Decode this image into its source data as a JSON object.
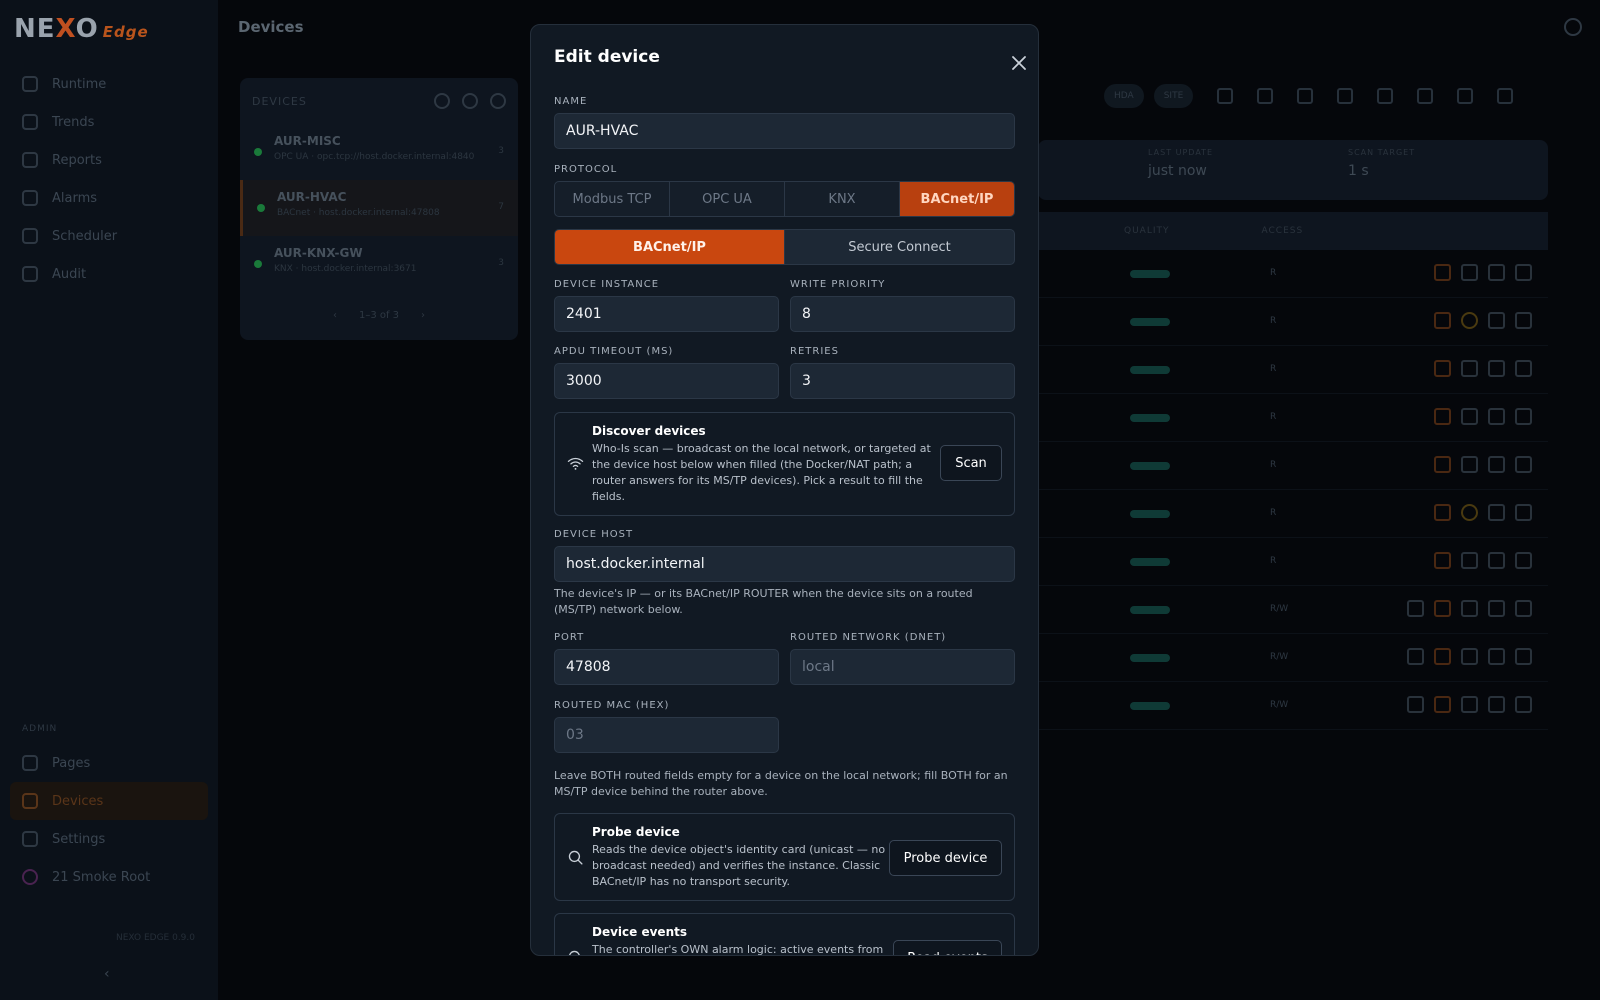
{
  "app": {
    "logo": {
      "part1": "NE",
      "part2": "X",
      "part3": "O",
      "suffix": "Edge"
    },
    "page_title": "Devices",
    "nav": [
      {
        "label": "Runtime"
      },
      {
        "label": "Trends"
      },
      {
        "label": "Reports"
      },
      {
        "label": "Alarms"
      },
      {
        "label": "Scheduler"
      },
      {
        "label": "Audit"
      }
    ],
    "nav_section": "ADMIN",
    "nav_bottom": [
      {
        "label": "Pages"
      },
      {
        "label": "Devices"
      },
      {
        "label": "Settings"
      },
      {
        "label": "21 Smoke Root"
      }
    ],
    "version": "NEXO EDGE 0.9.0",
    "devices_panel": {
      "header": "DEVICES",
      "items": [
        {
          "name": "AUR-MISC",
          "sub": "OPC UA · opc.tcp://host.docker.internal:4840",
          "count": "3"
        },
        {
          "name": "AUR-HVAC",
          "sub": "BACnet · host.docker.internal:47808",
          "count": "7"
        },
        {
          "name": "AUR-KNX-GW",
          "sub": "KNX · host.docker.internal:3671",
          "count": "3"
        }
      ],
      "pager": "1–3 of 3"
    },
    "summary": {
      "last_update_label": "LAST UPDATE",
      "last_update_value": "just now",
      "scan_target_label": "SCAN TARGET",
      "scan_target_value": "1 s"
    },
    "toolbar": {
      "pill1": "HDA",
      "pill2": "SITE"
    },
    "table": {
      "col_quality": "QUALITY",
      "col_access": "ACCESS",
      "rows": [
        "R",
        "R",
        "R",
        "R",
        "R",
        "R",
        "R",
        "R/W",
        "R/W",
        "R/W"
      ]
    }
  },
  "modal": {
    "title": "Edit device",
    "name_label": "NAME",
    "name_value": "AUR-HVAC",
    "protocol_label": "PROTOCOL",
    "protocols": [
      "Modbus TCP",
      "OPC UA",
      "KNX",
      "BACnet/IP"
    ],
    "protocol_selected": 3,
    "transports": [
      "BACnet/IP",
      "Secure Connect"
    ],
    "transport_selected": 0,
    "device_instance_label": "DEVICE INSTANCE",
    "device_instance_value": "2401",
    "write_priority_label": "WRITE PRIORITY",
    "write_priority_value": "8",
    "apdu_timeout_label": "APDU TIMEOUT (MS)",
    "apdu_timeout_value": "3000",
    "retries_label": "RETRIES",
    "retries_value": "3",
    "discover": {
      "title": "Discover devices",
      "text": "Who-Is scan — broadcast on the local network, or targeted at the device host below when filled (the Docker/NAT path; a router answers for its MS/TP devices). Pick a result to fill the fields.",
      "button": "Scan"
    },
    "device_host_label": "DEVICE HOST",
    "device_host_value": "host.docker.internal",
    "device_host_help": "The device's IP — or its BACnet/IP ROUTER when the device sits on a routed (MS/TP) network below.",
    "port_label": "PORT",
    "port_value": "47808",
    "routed_network_label": "ROUTED NETWORK (DNET)",
    "routed_network_placeholder": "local",
    "routed_mac_label": "ROUTED MAC (HEX)",
    "routed_mac_placeholder": "03",
    "routed_help": "Leave BOTH routed fields empty for a device on the local network; fill BOTH for an MS/TP device behind the router above.",
    "probe": {
      "title": "Probe device",
      "text": "Reads the device object's identity card (unicast — no broadcast needed) and verifies the instance. Classic BACnet/IP has no transport security.",
      "button": "Probe device"
    },
    "events": {
      "title": "Device events",
      "text": "The controller's OWN alarm logic: active events from",
      "button": "Read events"
    }
  },
  "colors": {
    "accent": "#c9470f",
    "modal_bg": "#111923",
    "field_bg": "#1d2835",
    "page_bg": "#05070b"
  }
}
